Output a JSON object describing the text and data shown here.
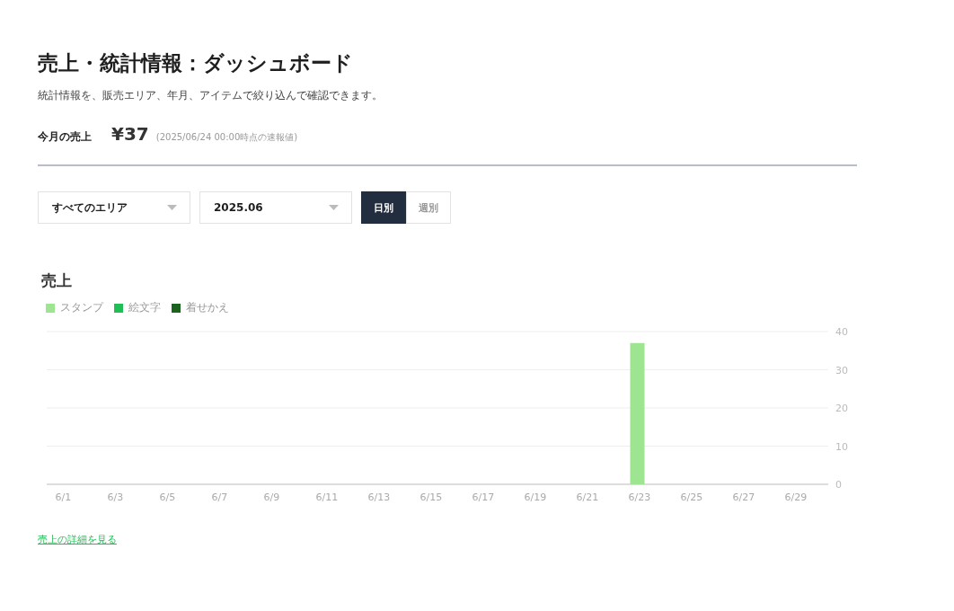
{
  "header": {
    "title": "売上・統計情報：ダッシュボード",
    "description": "統計情報を、販売エリア、年月、アイテムで絞り込んで確認できます。"
  },
  "monthly_sales": {
    "label": "今月の売上",
    "amount": "¥37",
    "note": "(2025/06/24 00:00時点の速報値)"
  },
  "filters": {
    "area": {
      "value": "すべてのエリア"
    },
    "month": {
      "value": "2025.06"
    },
    "period_tabs": [
      {
        "label": "日別",
        "selected": true
      },
      {
        "label": "週別",
        "selected": false
      }
    ]
  },
  "sales_chart": {
    "title": "売上",
    "chart_data": {
      "type": "bar",
      "stacked": true,
      "categories": [
        "6/1",
        null,
        "6/3",
        null,
        "6/5",
        null,
        "6/7",
        null,
        "6/9",
        null,
        "6/11",
        null,
        "6/13",
        null,
        "6/15",
        null,
        "6/17",
        null,
        "6/19",
        null,
        "6/21",
        null,
        "6/23",
        null,
        "6/25",
        null,
        "6/27",
        null,
        "6/29",
        null
      ],
      "series": [
        {
          "name": "スタンプ",
          "color": "#9ee592",
          "values": [
            0,
            0,
            0,
            0,
            0,
            0,
            0,
            0,
            0,
            0,
            0,
            0,
            0,
            0,
            0,
            0,
            0,
            0,
            0,
            0,
            0,
            0,
            37,
            0,
            0,
            0,
            0,
            0,
            0,
            0
          ]
        },
        {
          "name": "絵文字",
          "color": "#1fbf55",
          "values": [
            0,
            0,
            0,
            0,
            0,
            0,
            0,
            0,
            0,
            0,
            0,
            0,
            0,
            0,
            0,
            0,
            0,
            0,
            0,
            0,
            0,
            0,
            0,
            0,
            0,
            0,
            0,
            0,
            0,
            0
          ]
        },
        {
          "name": "着せかえ",
          "color": "#1d6320",
          "values": [
            0,
            0,
            0,
            0,
            0,
            0,
            0,
            0,
            0,
            0,
            0,
            0,
            0,
            0,
            0,
            0,
            0,
            0,
            0,
            0,
            0,
            0,
            0,
            0,
            0,
            0,
            0,
            0,
            0,
            0
          ]
        }
      ],
      "ylim": [
        0,
        40
      ],
      "yticks": [
        0,
        10,
        20,
        30,
        40
      ],
      "grid": true
    }
  },
  "details_link": "売上の詳細を見る"
}
